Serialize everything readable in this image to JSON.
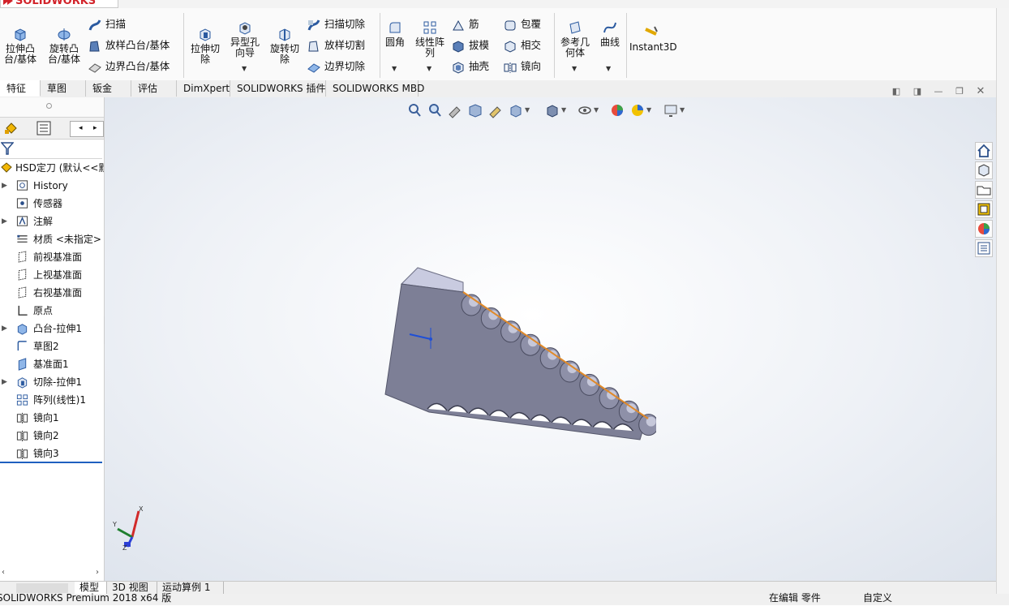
{
  "app": {
    "logo_text": "SOLIDWORKS",
    "status": "SOLIDWORKS Premium 2018 x64 版",
    "status_mode": "在编辑 零件",
    "status_units": "自定义"
  },
  "colors": {
    "accent_blue": "#1f5fbf",
    "part_face": "#7d7f96",
    "part_top": "#c9cbe0",
    "edge_orange": "#e08a2a"
  },
  "ribbon": {
    "extrude_boss": "拉伸凸\n台/基体",
    "revolve_boss": "旋转凸\n台/基体",
    "sweep": "扫描",
    "loft_boss": "放样凸台/基体",
    "boundary_boss": "边界凸台/基体",
    "extrude_cut": "拉伸切\n除",
    "hole_wizard": "异型孔\n向导",
    "revolve_cut": "旋转切\n除",
    "sweep_cut": "扫描切除",
    "loft_cut": "放样切割",
    "boundary_cut": "边界切除",
    "fillet": "圆角",
    "linear_pattern": "线性阵\n列",
    "rib": "筋",
    "draft": "拔模",
    "shell": "抽壳",
    "wrap": "包覆",
    "intersect": "相交",
    "mirror": "镜向",
    "ref_geometry": "参考几\n何体",
    "curves": "曲线",
    "instant3d": "Instant3D"
  },
  "tabs": [
    "特征",
    "草图",
    "钣金",
    "评估",
    "DimXpert",
    "SOLIDWORKS 插件",
    "SOLIDWORKS MBD"
  ],
  "tree": {
    "root": "HSD定刀 (默认<<默",
    "items": [
      "History",
      "传感器",
      "注解",
      "材质 <未指定>",
      "前视基准面",
      "上视基准面",
      "右视基准面",
      "原点",
      "凸台-拉伸1",
      "草图2",
      "基准面1",
      "切除-拉伸1",
      "阵列(线性)1",
      "镜向1",
      "镜向2",
      "镜向3"
    ]
  },
  "triad": {
    "x": "X",
    "y": "Y",
    "z": "Z"
  },
  "bottom_tabs": [
    "模型",
    "3D 视图",
    "运动算例 1"
  ]
}
